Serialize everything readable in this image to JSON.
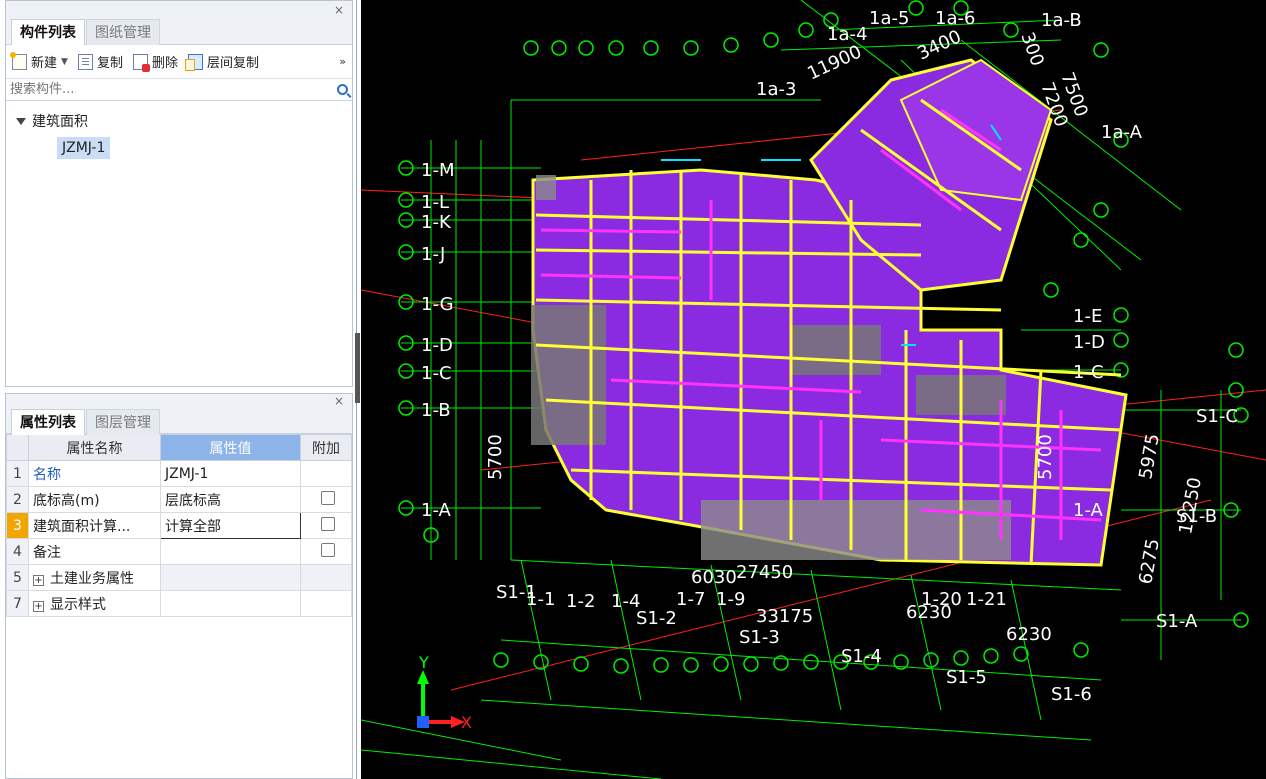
{
  "component_panel": {
    "tabs": [
      {
        "label": "构件列表",
        "active": true
      },
      {
        "label": "图纸管理",
        "active": false
      }
    ],
    "close_glyph": "×",
    "toolbar": {
      "new_label": "新建",
      "copy_label": "复制",
      "delete_label": "删除",
      "floor_copy_label": "层间复制",
      "more_glyph": "»"
    },
    "search_placeholder": "搜索构件...",
    "tree": {
      "root_label": "建筑面积",
      "child_label": "JZMJ-1"
    }
  },
  "property_panel": {
    "tabs": [
      {
        "label": "属性列表",
        "active": true
      },
      {
        "label": "图层管理",
        "active": false
      }
    ],
    "close_glyph": "×",
    "columns": [
      "属性名称",
      "属性值",
      "附加"
    ],
    "rows": [
      {
        "num": "1",
        "name": "名称",
        "value": "JZMJ-1",
        "checkbox": false,
        "expandable": false
      },
      {
        "num": "2",
        "name": "底标高(m)",
        "value": "层底标高",
        "checkbox": true,
        "expandable": false
      },
      {
        "num": "3",
        "name": "建筑面积计算...",
        "value": "计算全部",
        "checkbox": true,
        "expandable": false
      },
      {
        "num": "4",
        "name": "备注",
        "value": "",
        "checkbox": true,
        "expandable": false
      },
      {
        "num": "5",
        "name": "土建业务属性",
        "value": "",
        "checkbox": false,
        "expandable": true
      },
      {
        "num": "7",
        "name": "显示样式",
        "value": "",
        "checkbox": false,
        "expandable": true
      }
    ]
  },
  "cad_view": {
    "background": "#000000",
    "axis_x_label": "X",
    "axis_y_label": "Y",
    "axis_labels_top": [
      "1a-5",
      "1a-6",
      "1a-B",
      "1a-4",
      "1a-A",
      "1a-3"
    ],
    "axis_labels_left": [
      "1-M",
      "1-L",
      "1-K",
      "1-J",
      "1-G",
      "1-D",
      "1-C",
      "1-B",
      "1-A"
    ],
    "axis_labels_right": [
      "1-E",
      "1-D",
      "1-C",
      "1-A",
      "S1-C",
      "S1-B",
      "S1-A"
    ],
    "axis_labels_bottom": [
      "S1-1",
      "1-1",
      "1-2",
      "1-4",
      "S1-2",
      "1-7",
      "1-9",
      "S1-3",
      "S1-4",
      "S1-5",
      "S1-6",
      "1-20",
      "1-21"
    ],
    "dimension_labels": [
      "6030",
      "27450",
      "6230",
      "6230",
      "33175",
      "5975",
      "12250",
      "6275",
      "5700",
      "5700",
      "7500",
      "7200",
      "300",
      "11900",
      "3400"
    ],
    "colors": {
      "slab": "#8a2be2",
      "beam": "#ffff33",
      "wall": "#ff33ff",
      "grid": "#00ff00",
      "red_line": "#ff2020",
      "text": "#ffffff"
    }
  }
}
